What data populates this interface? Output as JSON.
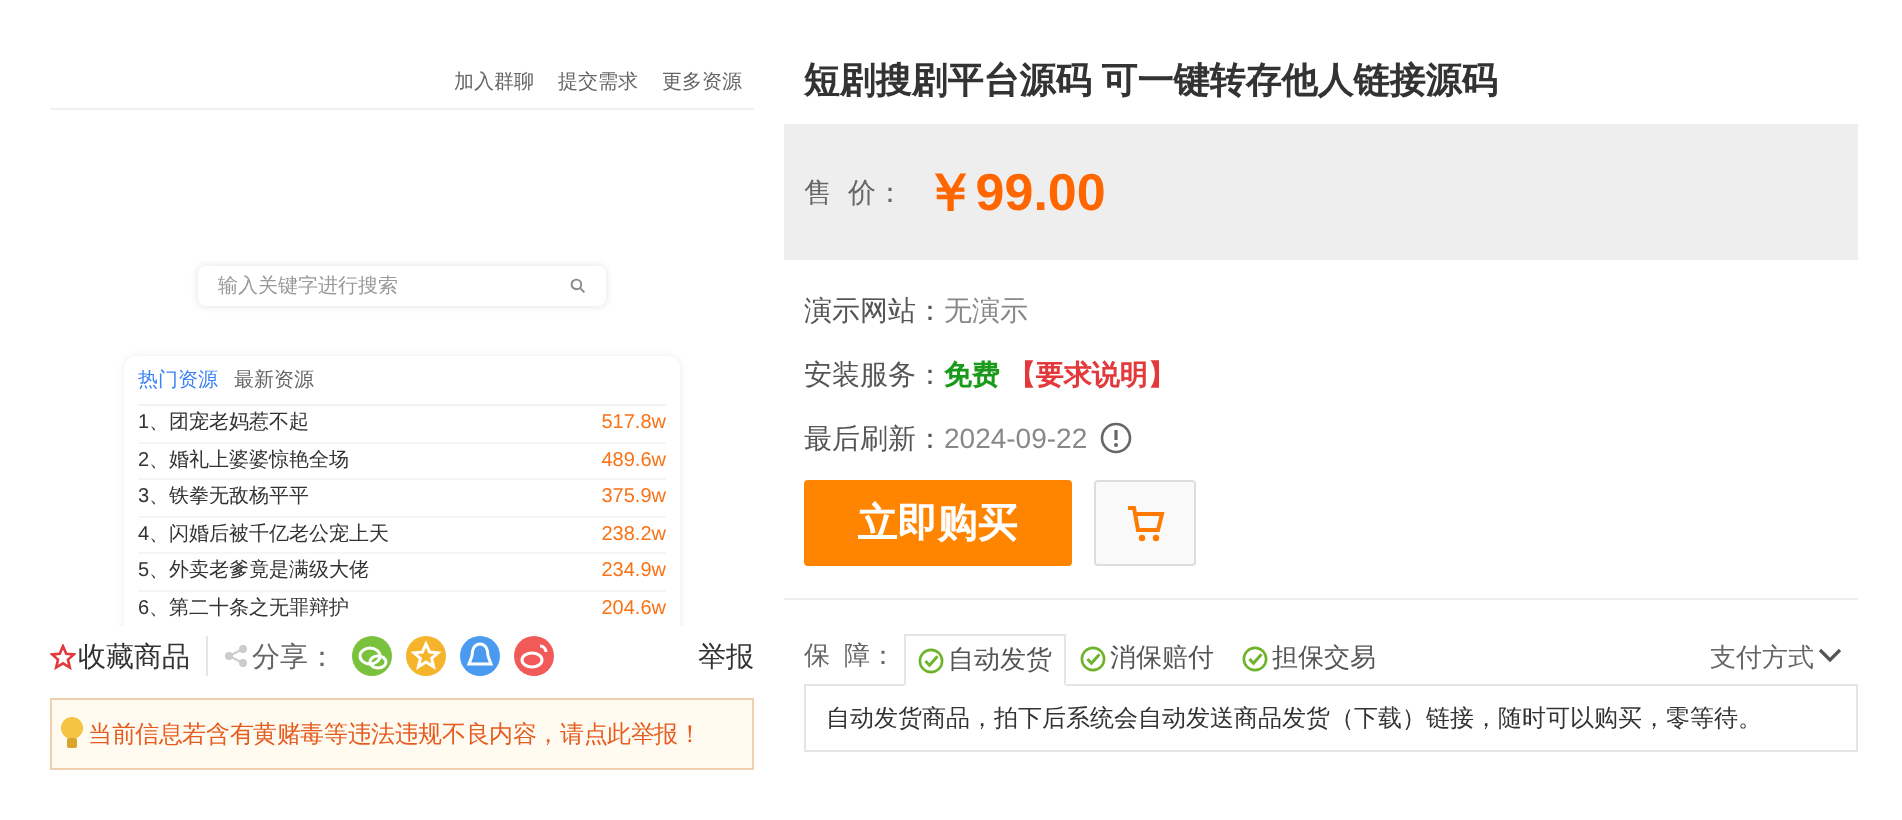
{
  "preview": {
    "nav_links": [
      "加入群聊",
      "提交需求",
      "更多资源"
    ],
    "search": {
      "placeholder": "输入关键字进行搜索"
    },
    "tabs": [
      {
        "label": "热门资源",
        "selected": true
      },
      {
        "label": "最新资源",
        "selected": false
      }
    ],
    "rows": [
      {
        "title": "1、团宠老妈惹不起",
        "count": "517.8w"
      },
      {
        "title": "2、婚礼上婆婆惊艳全场",
        "count": "489.6w"
      },
      {
        "title": "3、铁拳无敌杨平平",
        "count": "375.9w"
      },
      {
        "title": "4、闪婚后被千亿老公宠上天",
        "count": "238.2w"
      },
      {
        "title": "5、外卖老爹竟是满级大佬",
        "count": "234.9w"
      },
      {
        "title": "6、第二十条之无罪辩护",
        "count": "204.6w"
      }
    ]
  },
  "actions": {
    "collect": "收藏商品",
    "share_label": "分享：",
    "report": "举报"
  },
  "notice": "当前信息若含有黄赌毒等违法违规不良内容，请点此举报！",
  "product": {
    "title": "短剧搜剧平台源码 可一键转存他人链接源码",
    "price_label": "售  价：",
    "price": "￥99.00",
    "info": [
      {
        "label": "演示网站：",
        "value": "无演示",
        "kind": "plain"
      },
      {
        "label": "安装服务：",
        "value": "免费",
        "extra": "【要求说明】",
        "kind": "service"
      },
      {
        "label": "最后刷新：",
        "value": "2024-09-22",
        "kind": "date"
      }
    ],
    "buy_button": "立即购买",
    "guarantee_label": "保  障：",
    "guarantees": [
      {
        "label": "自动发货",
        "selected": true
      },
      {
        "label": "消保赔付",
        "selected": false
      },
      {
        "label": "担保交易",
        "selected": false
      }
    ],
    "payment": "支付方式",
    "description": "自动发货商品，拍下后系统会自动发送商品发货（下载）链接，随时可以购买，零等待。"
  }
}
